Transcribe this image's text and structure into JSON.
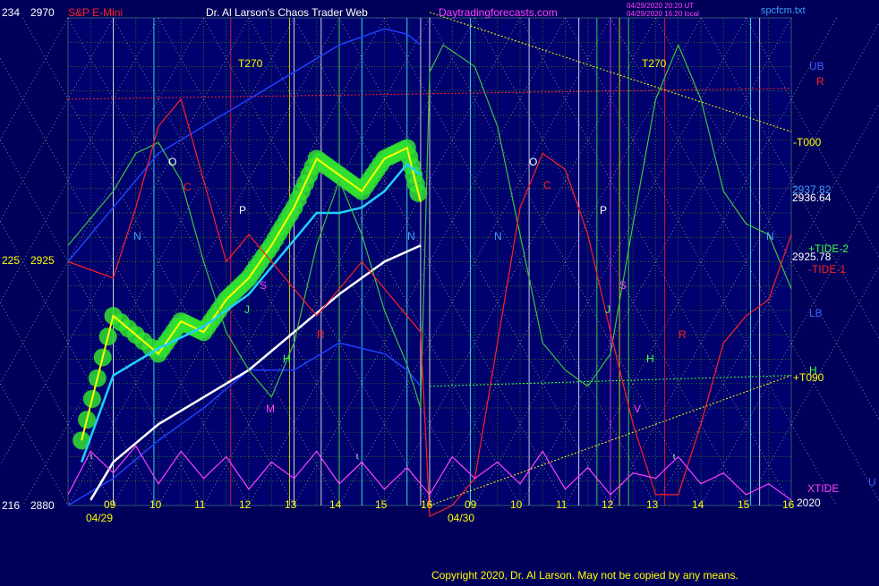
{
  "header": {
    "symbol": "S&P E-Mini",
    "author": "Dr. Al Larson's Chaos Trader Web",
    "site": "Daytradingforecasts.com",
    "timestamp1": "04/29/2020 20:20 UT",
    "timestamp2": "04/29/2020 16:20 local",
    "file": "spcfcm.txt",
    "copyright": "Copyright 2020, Dr. Al Larson. May not be copied by any means."
  },
  "left_scale": [
    {
      "a": "234",
      "b": "2970"
    },
    {
      "a": "225",
      "b": "2925"
    },
    {
      "a": "216",
      "b": "2880"
    }
  ],
  "right_labels": {
    "ub": "UB",
    "r": "R",
    "t000": "-T000",
    "p1": "2937.82",
    "p2": "2936.64",
    "tide2": "+TIDE-2",
    "p3": "2925.78",
    "tide1": "-TIDE-1",
    "lb": "LB",
    "h": "H",
    "t090": "+T090",
    "xtide": "XTIDE",
    "u": "U",
    "p4": "2020"
  },
  "markers": {
    "t270": "T270",
    "o": "O",
    "c": "C",
    "n": "N",
    "p": "P",
    "s": "S",
    "j": "J",
    "h": "H",
    "r": "R",
    "m": "M",
    "v": "V",
    "t": "t"
  },
  "chart_data": {
    "type": "line",
    "title": "S&P E-Mini",
    "x_ticks_day1": [
      "09",
      "10",
      "11",
      "12",
      "13",
      "14",
      "15",
      "16"
    ],
    "x_ticks_day2": [
      "09",
      "10",
      "11",
      "12",
      "13",
      "14",
      "15",
      "16"
    ],
    "dates": [
      "04/29",
      "04/30"
    ],
    "ylim": [
      2880,
      2970
    ],
    "secondary_ylim": [
      216,
      234
    ],
    "price_levels": [
      2937.82,
      2936.64,
      2925.78
    ],
    "series": [
      {
        "color": "#ffff00",
        "x": [
          0.3,
          1,
          2,
          2.5,
          3,
          3.5,
          4,
          4.5,
          5,
          5.5,
          6,
          6.5,
          7,
          7.5,
          7.8
        ],
        "y": [
          2892,
          2915,
          2908,
          2914,
          2912,
          2918,
          2922,
          2928,
          2935,
          2944,
          2941,
          2938,
          2944,
          2946,
          2936
        ]
      },
      {
        "color": "#20d0ff",
        "x": [
          0.3,
          1,
          2,
          3,
          4,
          5,
          5.5,
          6,
          6.5,
          7,
          7.5,
          7.8
        ],
        "y": [
          2888,
          2904,
          2909,
          2913,
          2919,
          2929,
          2934,
          2934,
          2935,
          2938,
          2943,
          2941
        ]
      },
      {
        "color": "#ffffff",
        "x": [
          0.5,
          1,
          2,
          3,
          4,
          5,
          6,
          7,
          7.8
        ],
        "y": [
          2881,
          2888,
          2895,
          2900,
          2905,
          2912,
          2919,
          2925,
          2928
        ]
      },
      {
        "color": "#40c040",
        "x": [
          0,
          1,
          1.5,
          2,
          2.5,
          3,
          3.5,
          4,
          4.5,
          5,
          5.5,
          6,
          6.5,
          7,
          7.5,
          7.8,
          8,
          8.3,
          9,
          9.5,
          10,
          10.5,
          11,
          11.5,
          12,
          12.5,
          13,
          13.5,
          14,
          14.5,
          15,
          15.5,
          16
        ],
        "y": [
          2928,
          2938,
          2945,
          2947,
          2940,
          2925,
          2912,
          2905,
          2900,
          2910,
          2928,
          2940,
          2930,
          2916,
          2906,
          2898,
          2960,
          2965,
          2961,
          2950,
          2930,
          2910,
          2905,
          2902,
          2908,
          2932,
          2955,
          2965,
          2955,
          2938,
          2932,
          2930,
          2920
        ]
      },
      {
        "color": "#ff2020",
        "x": [
          0,
          1,
          1.5,
          2,
          2.5,
          3,
          3.5,
          4,
          4.5,
          5,
          5.5,
          6,
          6.5,
          7,
          7.5,
          7.8,
          8,
          8.5,
          9,
          9.5,
          10,
          10.5,
          11,
          11.5,
          12,
          12.5,
          13,
          13.5,
          14,
          14.5,
          15,
          15.5,
          16
        ],
        "y": [
          2925,
          2922,
          2935,
          2950,
          2955,
          2940,
          2925,
          2930,
          2925,
          2920,
          2915,
          2920,
          2925,
          2920,
          2915,
          2912,
          2878,
          2880,
          2885,
          2910,
          2935,
          2945,
          2942,
          2930,
          2912,
          2895,
          2882,
          2882,
          2895,
          2910,
          2915,
          2918,
          2930
        ]
      },
      {
        "color": "#ff40ff",
        "x": [
          0,
          0.5,
          1,
          1.5,
          2,
          2.5,
          3,
          3.5,
          4,
          4.5,
          5,
          5.5,
          6,
          6.5,
          7,
          7.5,
          8,
          8.5,
          9,
          9.5,
          10,
          10.5,
          11,
          11.5,
          12,
          12.5,
          13,
          13.5,
          14,
          14.5,
          15,
          15.5,
          16
        ],
        "y": [
          2882,
          2890,
          2886,
          2891,
          2884,
          2890,
          2885,
          2889,
          2883,
          2888,
          2885,
          2890,
          2884,
          2888,
          2883,
          2887,
          2882,
          2889,
          2885,
          2888,
          2884,
          2890,
          2883,
          2887,
          2882,
          2886,
          2885,
          2889,
          2884,
          2886,
          2882,
          2884,
          2881
        ]
      }
    ]
  },
  "colors": {
    "background": "#00005a",
    "chart_bg": "#00006e",
    "grid": "#2a6b2a",
    "price": "#ffff00",
    "avg_fast": "#20d0ff",
    "avg_slow": "#ffffff",
    "tide1": "#ff2020",
    "tide2": "#40c040",
    "xtide": "#ff40ff",
    "ub_lb": "#2040ff"
  }
}
